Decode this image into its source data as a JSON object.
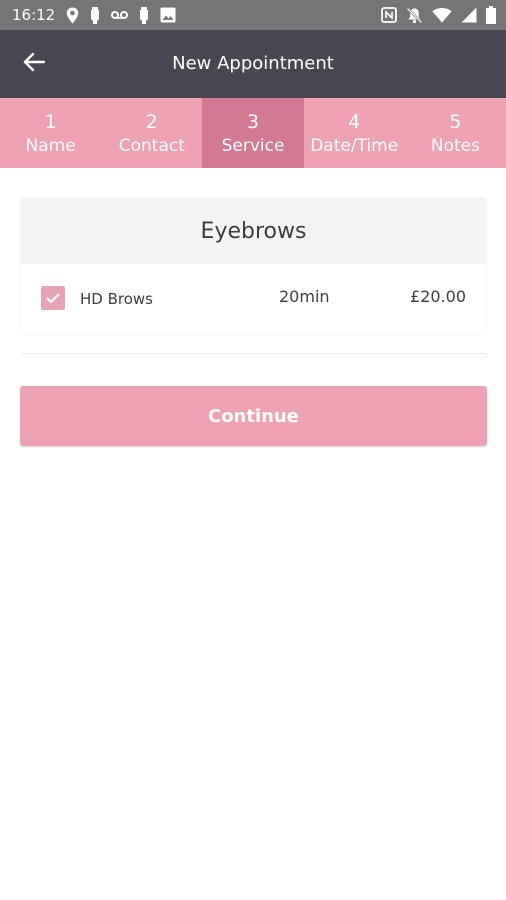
{
  "status_bar": {
    "time": "16:12",
    "left_icons": [
      "location-icon",
      "notification-icon",
      "voicemail-icon",
      "notification-icon",
      "image-icon"
    ],
    "right_icons": [
      "nfc-icon",
      "mute-icon",
      "wifi-icon",
      "signal-icon",
      "battery-icon"
    ]
  },
  "app_bar": {
    "title": "New Appointment",
    "back_icon": "arrow-left-icon"
  },
  "steps": [
    {
      "number": "1",
      "label": "Name",
      "active": false
    },
    {
      "number": "2",
      "label": "Contact",
      "active": false
    },
    {
      "number": "3",
      "label": "Service",
      "active": true
    },
    {
      "number": "4",
      "label": "Date/Time",
      "active": false
    },
    {
      "number": "5",
      "label": "Notes",
      "active": false
    }
  ],
  "category": {
    "title": "Eyebrows",
    "services": [
      {
        "checked": true,
        "name": "HD Brows",
        "duration": "20min",
        "price": "£20.00"
      }
    ]
  },
  "continue_label": "Continue",
  "colors": {
    "status_bar": "#757575",
    "app_bar": "#474751",
    "accent_pink": "#efa2b3",
    "active_step": "#d17893",
    "card_header": "#f2f3f3"
  }
}
